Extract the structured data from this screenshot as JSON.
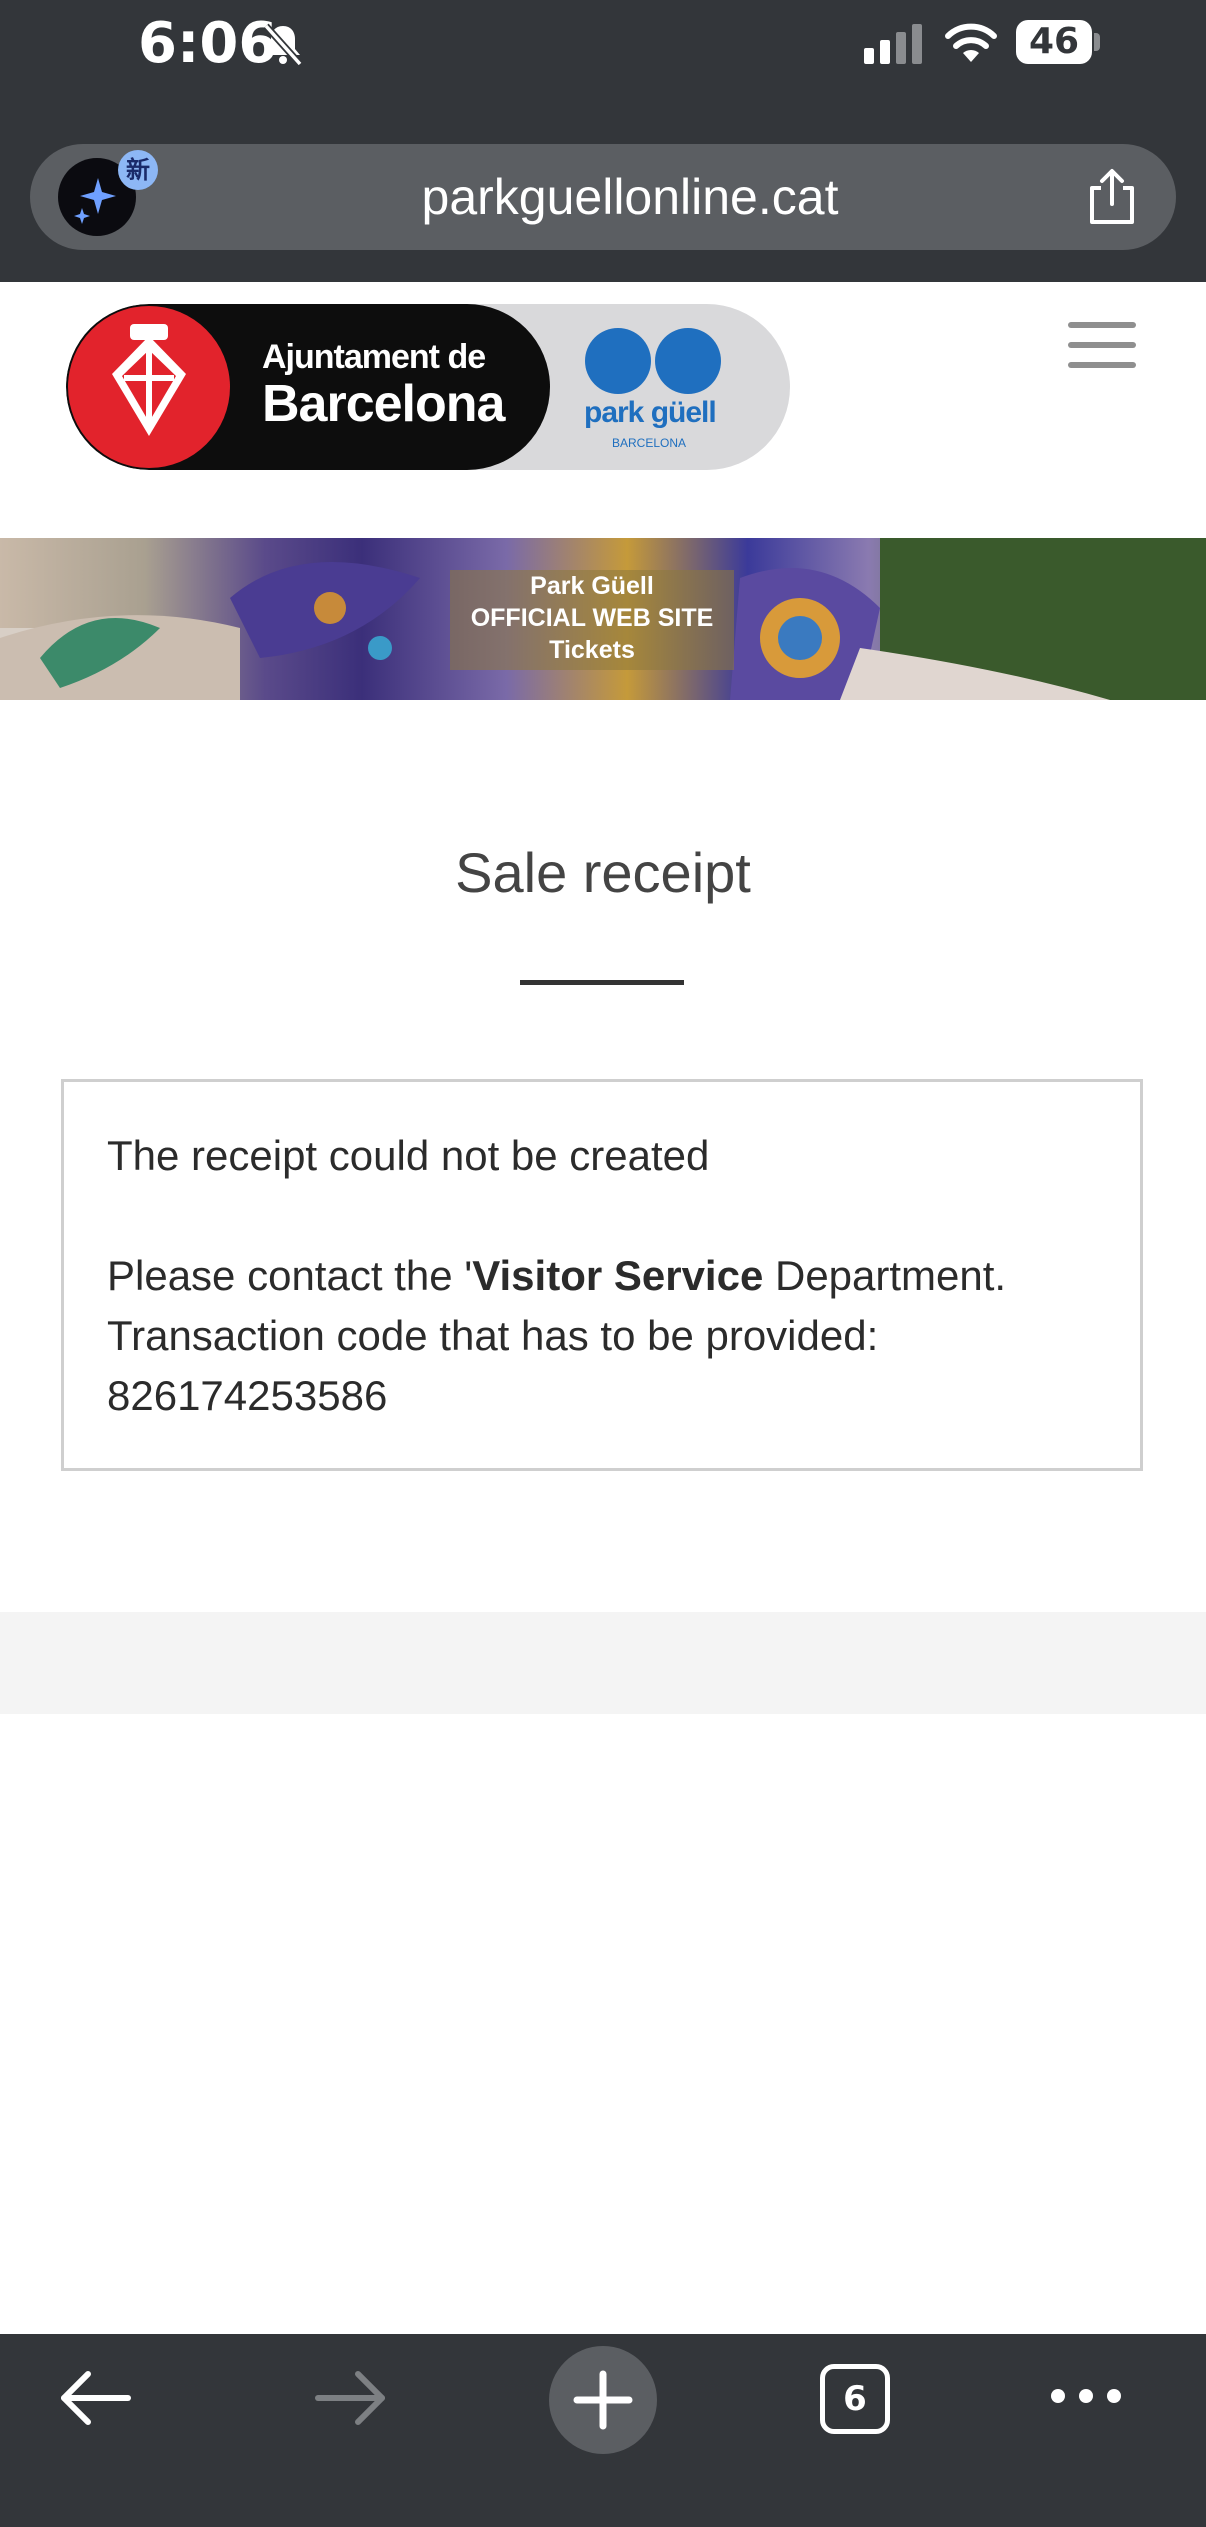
{
  "status_bar": {
    "time": "6:06",
    "battery": "46"
  },
  "browser": {
    "url": "parkguellonline.cat",
    "ai_badge": "新",
    "tab_count": "6"
  },
  "site": {
    "logo_line1": "Ajuntament de",
    "logo_line2": "Barcelona",
    "brand_name": "park güell",
    "brand_city": "BARCELONA",
    "banner_line1": "Park Güell",
    "banner_line2": "OFFICIAL WEB SITE",
    "banner_line3": "Tickets"
  },
  "receipt": {
    "title": "Sale receipt",
    "error_message": "The receipt could not be created",
    "contact_prefix": "Please contact the '",
    "contact_department": "Visitor Service",
    "contact_suffix": " Department.",
    "transaction_label": "Transaction code that has to be provided:",
    "transaction_code": "826174253586"
  },
  "colors": {
    "chrome_bg": "#33363a",
    "url_bar_bg": "#5b5e62",
    "city_red": "#e2232c",
    "park_blue": "#1f6fbf"
  }
}
